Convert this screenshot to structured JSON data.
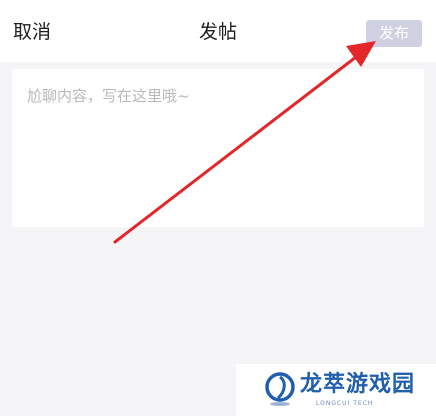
{
  "header": {
    "cancel_label": "取消",
    "title": "发帖",
    "publish_label": "发布",
    "publish_color": "#cfd1e2"
  },
  "compose": {
    "value": "",
    "placeholder": "尬聊内容，写在这里哦~"
  },
  "annotation": {
    "arrow_color": "#e3262a"
  },
  "watermark": {
    "name": "龙萃游戏园",
    "subtitle": "LONGCUI TECH"
  }
}
